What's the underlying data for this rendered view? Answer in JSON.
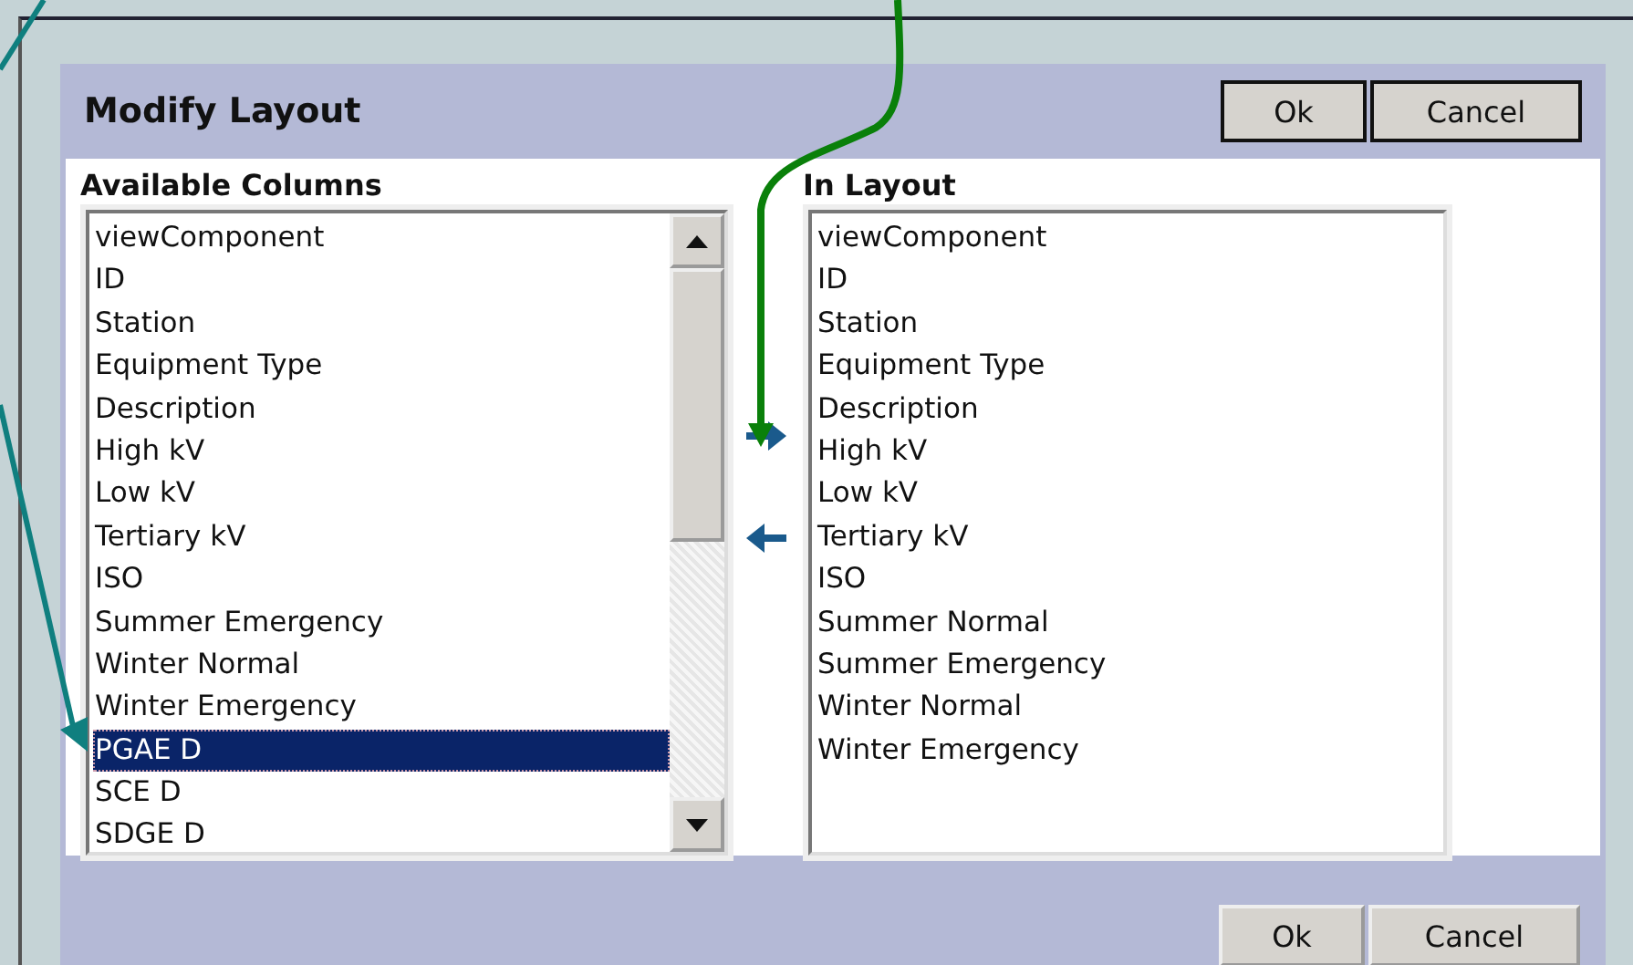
{
  "dialog": {
    "title": "Modify Layout",
    "header_buttons": [
      "Ok",
      "Cancel"
    ],
    "available": {
      "label": "Available Columns",
      "items": [
        {
          "text": "viewComponent",
          "selected": false
        },
        {
          "text": "ID",
          "selected": false
        },
        {
          "text": "Station",
          "selected": false
        },
        {
          "text": "Equipment Type",
          "selected": false
        },
        {
          "text": "Description",
          "selected": false
        },
        {
          "text": "High kV",
          "selected": false
        },
        {
          "text": "Low kV",
          "selected": false
        },
        {
          "text": "Tertiary kV",
          "selected": false
        },
        {
          "text": "ISO",
          "selected": false
        },
        {
          "text": "Summer Emergency",
          "selected": false
        },
        {
          "text": "Winter Normal",
          "selected": false
        },
        {
          "text": "Winter Emergency",
          "selected": false
        },
        {
          "text": "PGAE D",
          "selected": true
        },
        {
          "text": "SCE D",
          "selected": false
        },
        {
          "text": "SDGE D",
          "selected": false
        }
      ]
    },
    "in_layout": {
      "label": "In Layout",
      "items": [
        {
          "text": "viewComponent",
          "selected": false
        },
        {
          "text": "ID",
          "selected": false
        },
        {
          "text": "Station",
          "selected": false
        },
        {
          "text": "Equipment Type",
          "selected": false
        },
        {
          "text": "Description",
          "selected": false
        },
        {
          "text": "High kV",
          "selected": false
        },
        {
          "text": "Low kV",
          "selected": false
        },
        {
          "text": "Tertiary kV",
          "selected": false
        },
        {
          "text": "ISO",
          "selected": false
        },
        {
          "text": "Summer Normal",
          "selected": false
        },
        {
          "text": "Summer Emergency",
          "selected": false
        },
        {
          "text": "Winter Normal",
          "selected": false
        },
        {
          "text": "Winter Emergency",
          "selected": false
        }
      ]
    },
    "footer_buttons": [
      "Ok",
      "Cancel"
    ]
  }
}
